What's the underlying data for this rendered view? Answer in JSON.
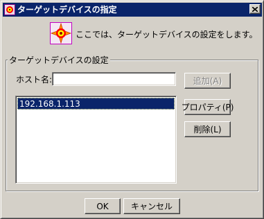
{
  "window": {
    "title": "ターゲットデバイスの指定",
    "close_symbol": "✕",
    "title_icon": "app-icon"
  },
  "header": {
    "icon": "target-device-icon",
    "text": "ここでは、ターゲットデバイスの設定をします。"
  },
  "group": {
    "label": "ターゲットデバイスの設定",
    "host_label": "ホスト名:",
    "host_value": "",
    "items": [
      {
        "label": "192.168.1.113",
        "selected": true
      }
    ]
  },
  "buttons": {
    "add": "追加(A)",
    "properties": "プロパティ(P)",
    "delete": "削除(L)",
    "ok": "OK",
    "cancel": "キャンセル"
  },
  "colors": {
    "titlebar": "#0a246a",
    "face": "#d4d0c8",
    "selection": "#0a246a"
  }
}
